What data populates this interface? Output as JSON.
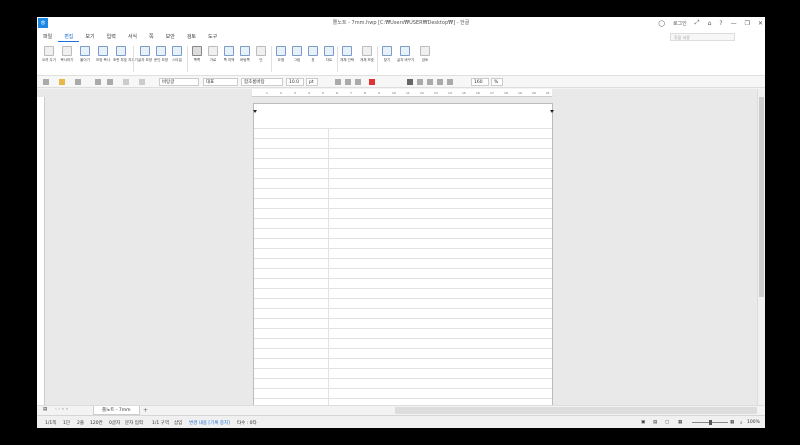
{
  "window": {
    "title": "쫄노트 - 7mm.hwp [C:₩Users₩USER₩Desktop₩] - 한글",
    "login": "로그인",
    "app_icon": "ㅎ"
  },
  "menu": {
    "items": [
      "파일",
      "편집",
      "보기",
      "입력",
      "서식",
      "쪽",
      "보안",
      "검토",
      "도구"
    ],
    "active": "편집",
    "search_placeholder": "찾을 내용"
  },
  "ribbon": {
    "buttons": [
      "오려 두기",
      "복사하기",
      "붙이기",
      "모양 복사",
      "조판 부호 지우기",
      "글자 모양",
      "문단 모양",
      "스타일",
      "쪽쪽",
      "가로",
      "쪽 여백",
      "바탕쪽",
      "단",
      "도형",
      "그림",
      "표",
      "차트",
      "개체 선택",
      "개체 보호",
      "찾기",
      "글자 바꾸기",
      "검토"
    ]
  },
  "format": {
    "style": "바탕글",
    "lang": "대표",
    "font": "함초롬바탕",
    "size": "10.0",
    "unit": "pt",
    "zoom_field": "160",
    "zoom_unit": "%"
  },
  "ruler": {
    "ticks": [
      "1",
      "2",
      "3",
      "4",
      "5",
      "6",
      "7",
      "8",
      "9",
      "10",
      "11",
      "12",
      "13",
      "14",
      "15",
      "16",
      "17",
      "18",
      "19",
      "20",
      "21"
    ]
  },
  "tabs": {
    "doc": "쫄노트 - 7mm"
  },
  "status": {
    "page": "1/1쪽",
    "section": "1단",
    "line": "2줄",
    "col": "120칸",
    "chars": "0글자",
    "mode": "문자 입력",
    "area": "1/1 구역",
    "insert": "삽입",
    "track": "변경 내용 [기록 중지]",
    "extra": "타수 : 0타",
    "zoom": "100%"
  }
}
